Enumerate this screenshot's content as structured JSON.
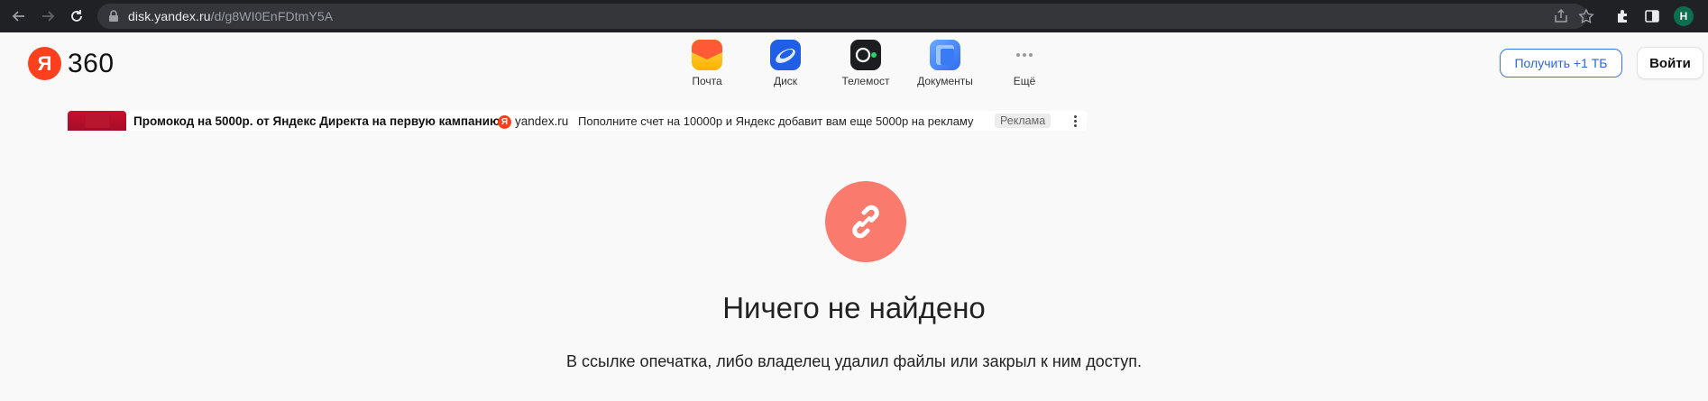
{
  "browser": {
    "url_host": "disk.yandex.ru",
    "url_path": "/d/g8WI0EnFDtmY5A",
    "profile_initial": "Н"
  },
  "header": {
    "logo_letter": "Я",
    "logo_text": "360",
    "services": [
      {
        "label": "Почта",
        "icon": "mail-icon"
      },
      {
        "label": "Диск",
        "icon": "disk-icon"
      },
      {
        "label": "Телемост",
        "icon": "telemost-icon"
      },
      {
        "label": "Документы",
        "icon": "documents-icon"
      },
      {
        "label": "Ещё",
        "icon": "more-dots-icon"
      }
    ],
    "get_plus_label": "Получить +1 ТБ",
    "login_label": "Войти"
  },
  "ad": {
    "title": "Промокод на 5000р. от Яндекс Директа на первую кампанию",
    "domain_letter": "Я",
    "domain": "yandex.ru",
    "text": "Пополните счет на 10000р и Яндекс добавит вам еще 5000р на рекламу",
    "label": "Реклама"
  },
  "main": {
    "title": "Ничего не найдено",
    "description": "В ссылке опечатка, либо владелец удалил файлы или закрыл к ним доступ."
  },
  "colors": {
    "yandex_red": "#fc3f1d",
    "accent_blue": "#3a73e8",
    "broken_link_circle": "#fa7b6e"
  }
}
